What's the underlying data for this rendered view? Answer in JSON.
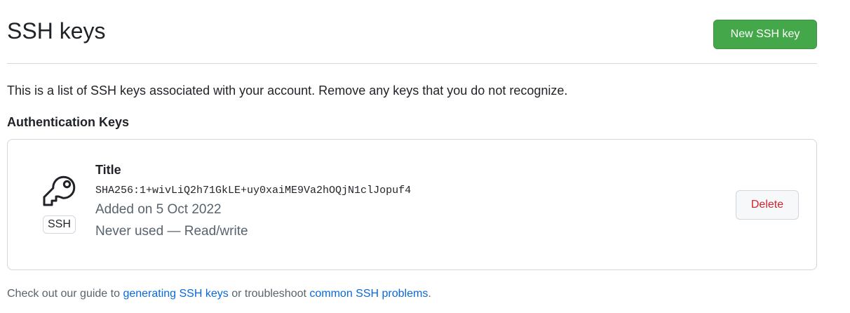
{
  "header": {
    "title": "SSH keys",
    "new_key_label": "New SSH key"
  },
  "intro": "This is a list of SSH keys associated with your account. Remove any keys that you do not recognize.",
  "section": {
    "heading": "Authentication Keys"
  },
  "keys": [
    {
      "icon": "key-icon",
      "type_badge": "SSH",
      "title": "Title",
      "fingerprint": "SHA256:1+wivLiQ2h71GkLE+uy0xaiME9Va2hOQjN1clJopuf4",
      "added": "Added on 5 Oct 2022",
      "usage": "Never used — Read/write",
      "delete_label": "Delete"
    }
  ],
  "footer": {
    "prefix": "Check out our guide to ",
    "link_generating": "generating SSH keys",
    "middle": " or troubleshoot ",
    "link_problems": "common SSH problems",
    "suffix": "."
  },
  "colors": {
    "primary_button": "#44a84a",
    "danger_text": "#d1242f",
    "link": "#0969da",
    "muted_text": "#59636e",
    "border": "#d0d7de"
  }
}
